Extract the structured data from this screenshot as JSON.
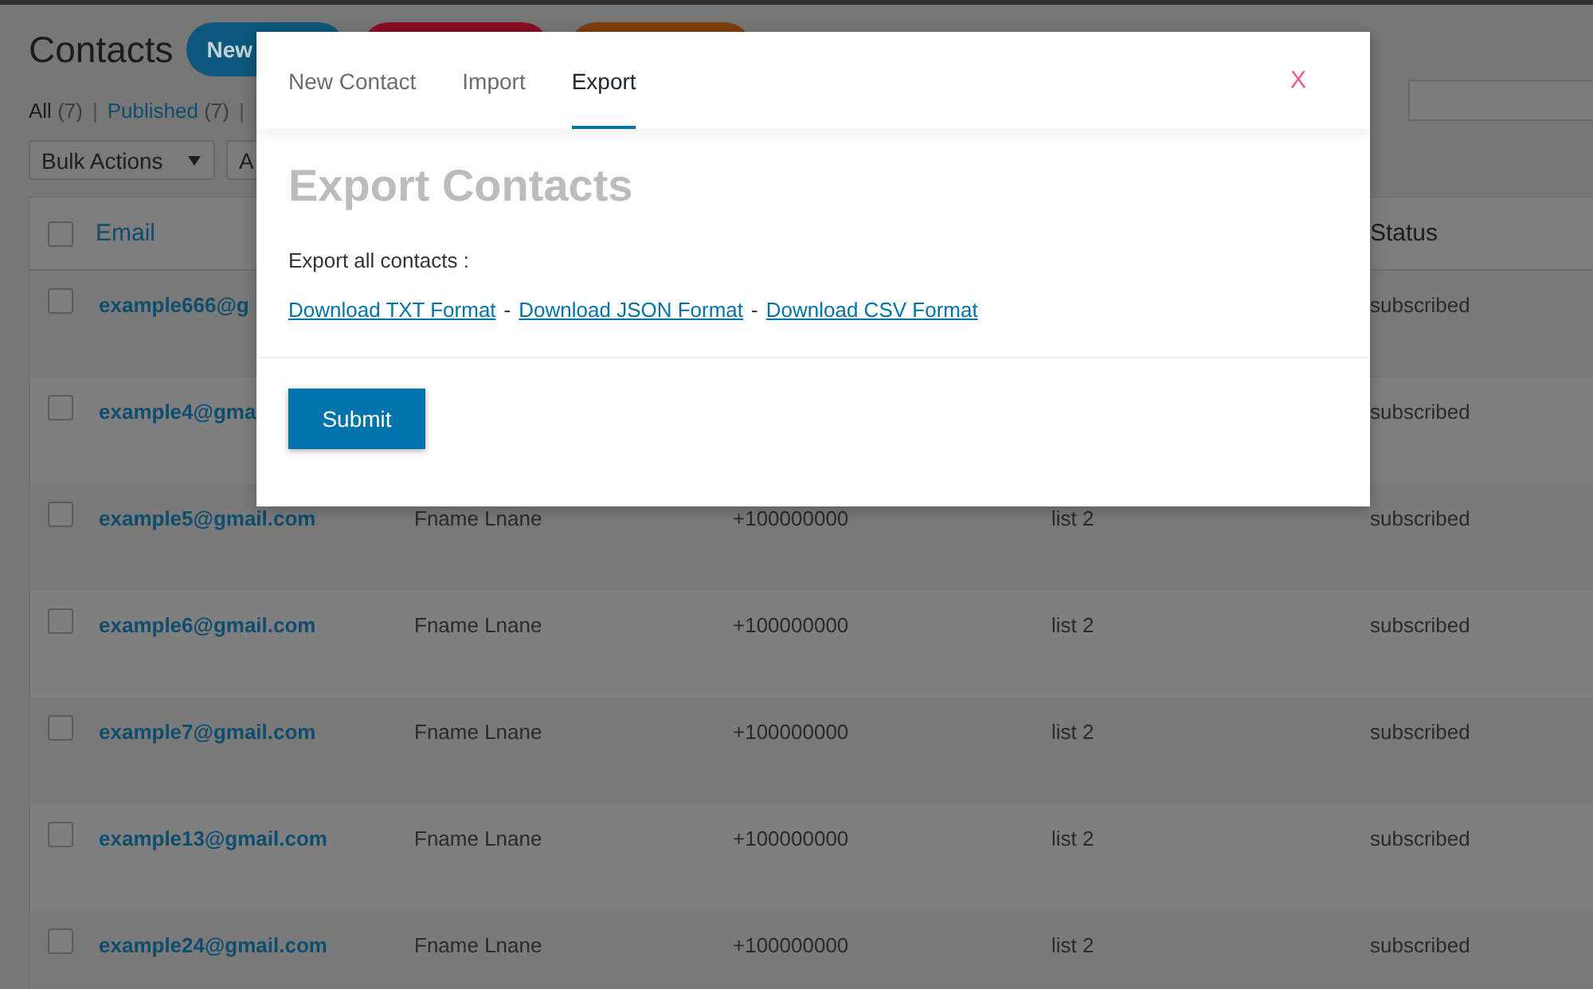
{
  "admin_page": {
    "title": "Contacts",
    "header_buttons": [
      {
        "label": "New",
        "color": "#0d587c"
      },
      {
        "color": "#8a0e26"
      },
      {
        "color": "#80400d"
      }
    ],
    "filters": [
      {
        "label": "All",
        "count": "(7)",
        "selected": true
      },
      {
        "label": "Published",
        "count": "(7)",
        "selected": false
      }
    ],
    "filter_separator": "|",
    "bulk_actions": {
      "value": "Bulk Actions"
    },
    "apply_button": "A",
    "table": {
      "header_checkbox": {
        "checked": false
      },
      "columns": [
        "Email",
        "Status"
      ],
      "rows": [
        {
          "checked": false,
          "email": "example666@g",
          "status": "subscribed"
        },
        {
          "checked": false,
          "email": "example4@gma",
          "status": "subscribed"
        },
        {
          "checked": false,
          "email": "example5@gmail.com",
          "name": "Fname Lnane",
          "phone": "+100000000",
          "list": "list 2",
          "status": "subscribed"
        },
        {
          "checked": false,
          "email": "example6@gmail.com",
          "name": "Fname Lnane",
          "phone": "+100000000",
          "list": "list 2",
          "status": "subscribed"
        },
        {
          "checked": false,
          "email": "example7@gmail.com",
          "name": "Fname Lnane",
          "phone": "+100000000",
          "list": "list 2",
          "status": "subscribed"
        },
        {
          "checked": false,
          "email": "example13@gmail.com",
          "name": "Fname Lnane",
          "phone": "+100000000",
          "list": "list 2",
          "status": "subscribed"
        },
        {
          "checked": false,
          "email": "example24@gmail.com",
          "name": "Fname Lnane",
          "phone": "+100000000",
          "list": "list 2",
          "status": "subscribed"
        }
      ]
    }
  },
  "modal": {
    "tabs": [
      {
        "label": "New Contact",
        "selected": false
      },
      {
        "label": "Import",
        "selected": false
      },
      {
        "label": "Export",
        "selected": true
      }
    ],
    "close": "X",
    "heading": "Export Contacts",
    "intro": "Export all contacts :",
    "links": [
      "Download TXT Format",
      "Download JSON Format",
      "Download CSV Format"
    ],
    "link_separator": "-",
    "submit": "Submit"
  }
}
